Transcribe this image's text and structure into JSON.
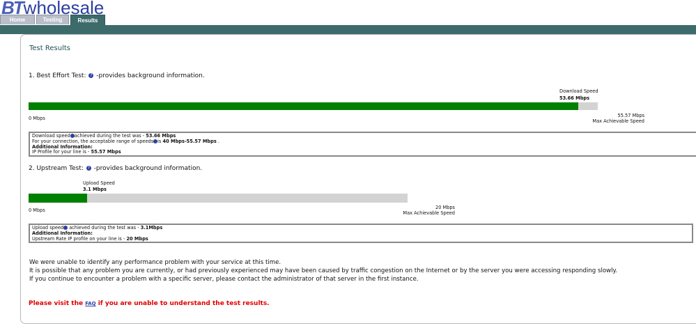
{
  "header": {
    "logo_bt": "BT",
    "logo_wholesale": "wholesale",
    "tabs": [
      {
        "label": "Home",
        "active": false
      },
      {
        "label": "Testing",
        "active": false
      },
      {
        "label": "Results",
        "active": true
      }
    ]
  },
  "panel": {
    "title": "Test Results"
  },
  "download": {
    "heading_prefix": "1. Best Effort Test:",
    "heading_suffix": "-provides background information.",
    "speed_label": "Download Speed",
    "speed_value": "53.66 Mbps",
    "min_label": "0 Mbps",
    "max_value": "55.57 Mbps",
    "max_label": "Max Achievable Speed",
    "progress_fraction": 0.9656,
    "info": {
      "line1_prefix": "Download speed",
      "line1_mid": "achieved during the test was - ",
      "line1_value": "53.66 Mbps",
      "line2_prefix": "For your connection, the acceptable range of speeds",
      "line2_mid": "is ",
      "line2_value": "40 Mbps-55.57 Mbps",
      "line2_end": " .",
      "additional_label": "Additional Information:",
      "line4_prefix": "IP Profile for your line is - ",
      "line4_value": "55.57 Mbps"
    }
  },
  "upload": {
    "heading_prefix": "2. Upstream Test:",
    "heading_suffix": "-provides background information.",
    "speed_label": "Upload Speed",
    "speed_value": "3.1 Mbps",
    "min_label": "0 Mbps",
    "max_value": "20 Mbps",
    "max_label": "Max Achievable Speed",
    "progress_fraction": 0.155,
    "info": {
      "line1_prefix": "Upload speed",
      "line1_mid": " achieved during the test was - ",
      "line1_value": "3.1Mbps",
      "additional_label": "Additional Information:",
      "line3_prefix": "Upstream Rate IP profile on your line is - ",
      "line3_value": "20 Mbps"
    }
  },
  "messages": [
    "We were unable to identify any performance problem with your service at this time.",
    "It is possible that any problem you are currently, or had previously experienced may have been caused by traffic congestion on the Internet or by the server you were accessing responding slowly.",
    "If you continue to encounter a problem with a specific server, please contact the administrator of that server in the first instance."
  ],
  "faq": {
    "prefix": "Please visit the ",
    "link": "FAQ",
    "suffix": " if you are unable to understand the test results."
  },
  "colors": {
    "brand": "#2c3fa0",
    "nav": "#3d6b6b",
    "bar_fill": "#008000",
    "bar_track": "#d3d3d3",
    "alert": "#e00000"
  }
}
